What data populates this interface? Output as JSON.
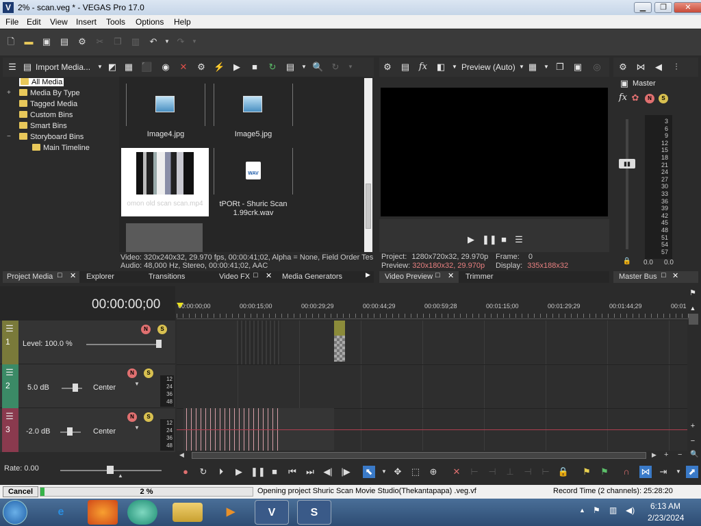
{
  "window": {
    "title": "2% - scan.veg * - VEGAS Pro 17.0",
    "app_icon": "V",
    "min": "▁",
    "max": "❐",
    "close": "✕"
  },
  "menu": [
    "File",
    "Edit",
    "View",
    "Insert",
    "Tools",
    "Options",
    "Help"
  ],
  "media_toolbar": {
    "import_label": "Import Media..."
  },
  "tree": [
    {
      "label": "All Media",
      "expander": ""
    },
    {
      "label": "Media By Type",
      "expander": "+"
    },
    {
      "label": "Tagged Media",
      "expander": ""
    },
    {
      "label": "Custom Bins",
      "expander": ""
    },
    {
      "label": "Smart Bins",
      "expander": ""
    },
    {
      "label": "Storyboard Bins",
      "expander": "−"
    },
    {
      "label": "Main Timeline",
      "expander": ""
    }
  ],
  "media_items": [
    {
      "name": "Image4.jpg"
    },
    {
      "name": "Image5.jpg"
    },
    {
      "name": "omon old scan scan.mp4"
    },
    {
      "name": "tPORt - Shuric Scan 1.99crk.wav",
      "badge": "WAV"
    }
  ],
  "media_info": {
    "video": "Video: 320x240x32, 29.970 fps, 00:00:41;02, Alpha = None, Field Order Tes",
    "audio": "Audio: 48,000 Hz, Stereo, 00:00:41;02, AAC"
  },
  "left_tabs": [
    "Project Media",
    "Explorer",
    "Transitions",
    "Video FX",
    "Media Generators"
  ],
  "preview": {
    "mode": "Preview (Auto)",
    "project_label": "Project:",
    "project_value": "1280x720x32, 29.970p",
    "preview_label": "Preview:",
    "preview_value": "320x180x32, 29.970p",
    "frame_label": "Frame:",
    "frame_value": "0",
    "display_label": "Display:",
    "display_value": "335x188x32"
  },
  "preview_tabs": [
    "Video Preview",
    "Trimmer"
  ],
  "master": {
    "title": "Master",
    "tab": "Master Bus",
    "left_value": "0.0",
    "right_value": "0.0",
    "scale": [
      "3",
      "6",
      "9",
      "12",
      "15",
      "18",
      "21",
      "24",
      "27",
      "30",
      "33",
      "36",
      "39",
      "42",
      "45",
      "48",
      "51",
      "54",
      "57"
    ]
  },
  "timecode": "00:00:00;00",
  "ruler": [
    "00:00:00;00",
    "00:00:15;00",
    "00:00:29;29",
    "00:00:44;29",
    "00:00:59;28",
    "00:01:15;00",
    "00:01:29;29",
    "00:01:44;29",
    "00:01"
  ],
  "tracks": [
    {
      "num": "1",
      "level": "Level: 100.0 %",
      "color": "#7a7a3a"
    },
    {
      "num": "2",
      "vol": "5.0 dB",
      "pan": "Center",
      "color": "#3b8a66",
      "scale": [
        "12",
        "24",
        "36",
        "48"
      ]
    },
    {
      "num": "3",
      "vol": "-2.0 dB",
      "pan": "Center",
      "color": "#8a3a4e",
      "scale": [
        "12",
        "24",
        "36",
        "48"
      ]
    }
  ],
  "rate": "Rate: 0.00",
  "status": {
    "cancel": "Cancel",
    "percent": "2 %",
    "progress": 0.02,
    "message": "Opening project Shuric Scan Movie Studio(Thekantapapa) .veg.vf",
    "record_time": "Record Time (2 channels): 25:28:20"
  },
  "taskbar": {
    "time": "6:13 AM",
    "date": "2/23/2024"
  }
}
